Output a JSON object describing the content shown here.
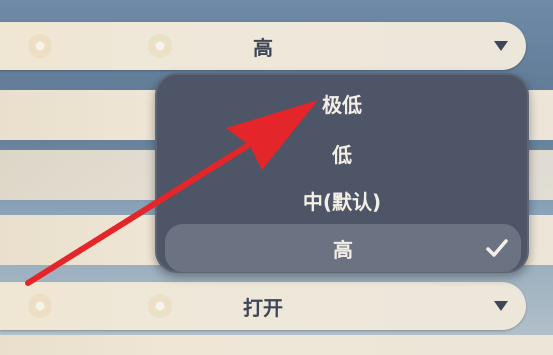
{
  "settings": {
    "row1": {
      "value": "高",
      "icon": "chevron-down-icon"
    },
    "row_open": {
      "value": "打开",
      "icon": "chevron-down-icon"
    }
  },
  "dropdown": {
    "options": [
      {
        "label": "极低"
      },
      {
        "label": "低"
      },
      {
        "label": "中(默认)"
      },
      {
        "label": "高",
        "selected": true,
        "icon": "checkmark-icon"
      }
    ]
  },
  "colors": {
    "row_background": "#efe6d3",
    "row_text": "#3f4657",
    "dropdown_background": "#4d5566",
    "selected_background": "#6b7282",
    "annotation_arrow": "#e4252a"
  }
}
